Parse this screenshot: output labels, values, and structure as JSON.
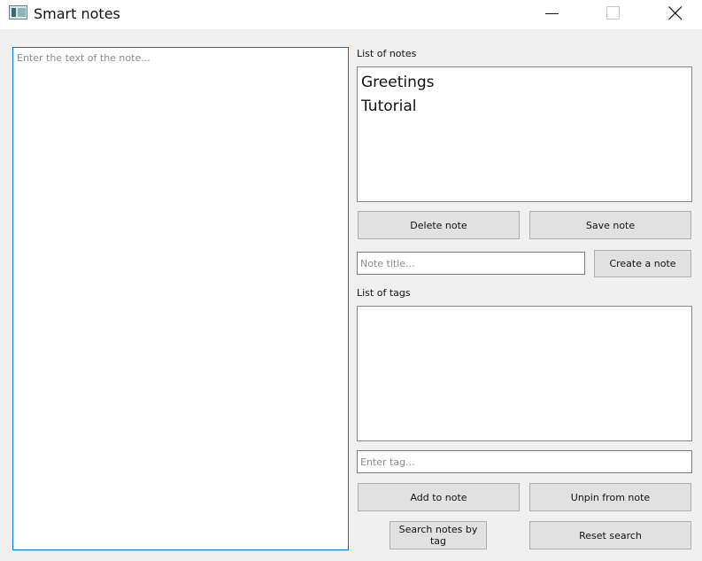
{
  "window": {
    "title": "Smart notes",
    "icon": "app-icon",
    "controls": [
      "minimize-icon",
      "maximize-icon",
      "close-icon"
    ]
  },
  "editor": {
    "placeholder": "Enter the text of the note...",
    "value": ""
  },
  "notes": {
    "label": "List of notes",
    "items": [
      {
        "label": "Greetings"
      },
      {
        "label": "Tutorial"
      }
    ],
    "delete_label": "Delete note",
    "save_label": "Save note",
    "title_placeholder": "Note title...",
    "create_label": "Create a note"
  },
  "tags": {
    "label": "List of tags",
    "items": [],
    "input_placeholder": "Enter tag...",
    "add_label": "Add to note",
    "unpin_label": "Unpin from note",
    "search_label": "Search notes by tag",
    "reset_label": "Reset search"
  },
  "colors": {
    "window_bg": "#f0f0f0",
    "focus_border": "#0078d7",
    "button_bg": "#e1e1e1"
  }
}
